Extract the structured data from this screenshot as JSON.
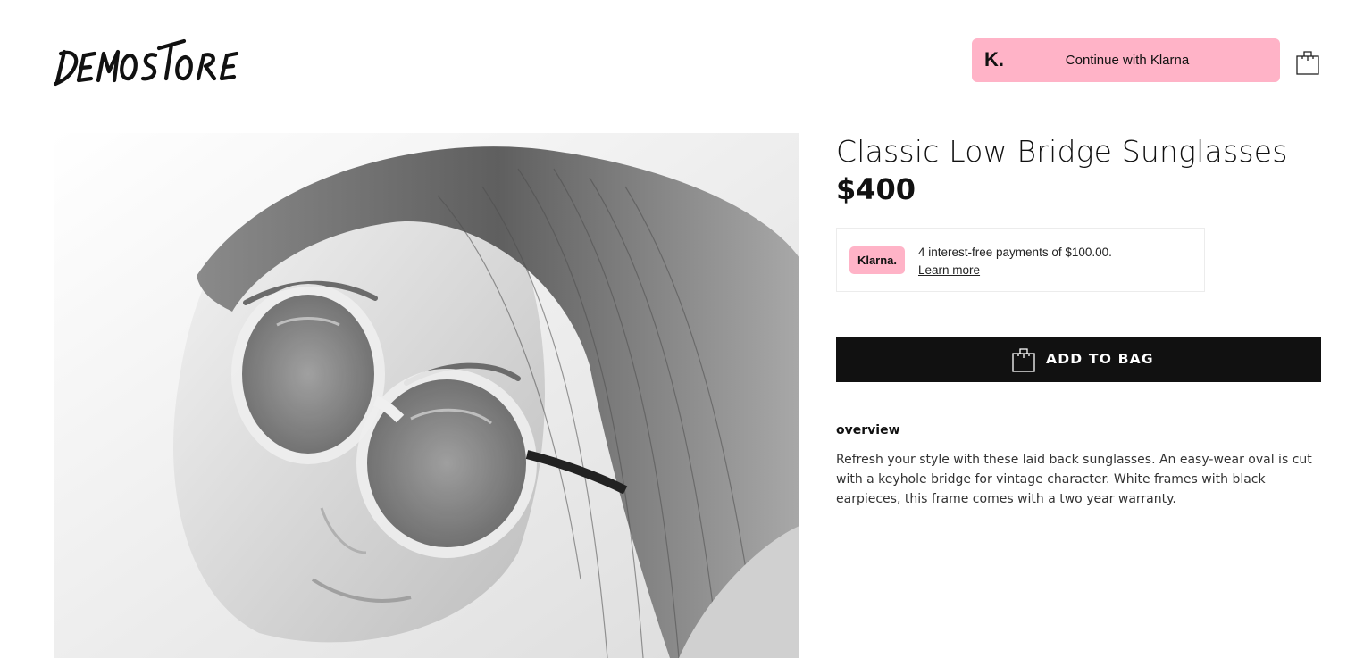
{
  "header": {
    "logo_text": "DEMOSTORE",
    "klarna_cta": {
      "mark": "K.",
      "label": "Continue with Klarna",
      "color": "#ffb3c7"
    },
    "cart_icon": "shopping-bag-icon"
  },
  "product": {
    "title": "Classic Low Bridge Sunglasses",
    "price": "$400",
    "image_icon": "product-photo"
  },
  "klarna_promo": {
    "badge": "Klarna.",
    "message": "4 interest-free payments of $100.00.",
    "learn_more": "Learn more",
    "badge_color": "#ffb3c7"
  },
  "add_to_bag": {
    "label": "ADD TO BAG",
    "icon": "shopping-bag-icon",
    "color": "#111111"
  },
  "overview": {
    "heading": "overview",
    "text": "Refresh your style with these laid back sunglasses. An easy-wear oval is cut with a keyhole bridge for vintage character. White frames with black earpieces, this frame comes with a two year warranty."
  }
}
